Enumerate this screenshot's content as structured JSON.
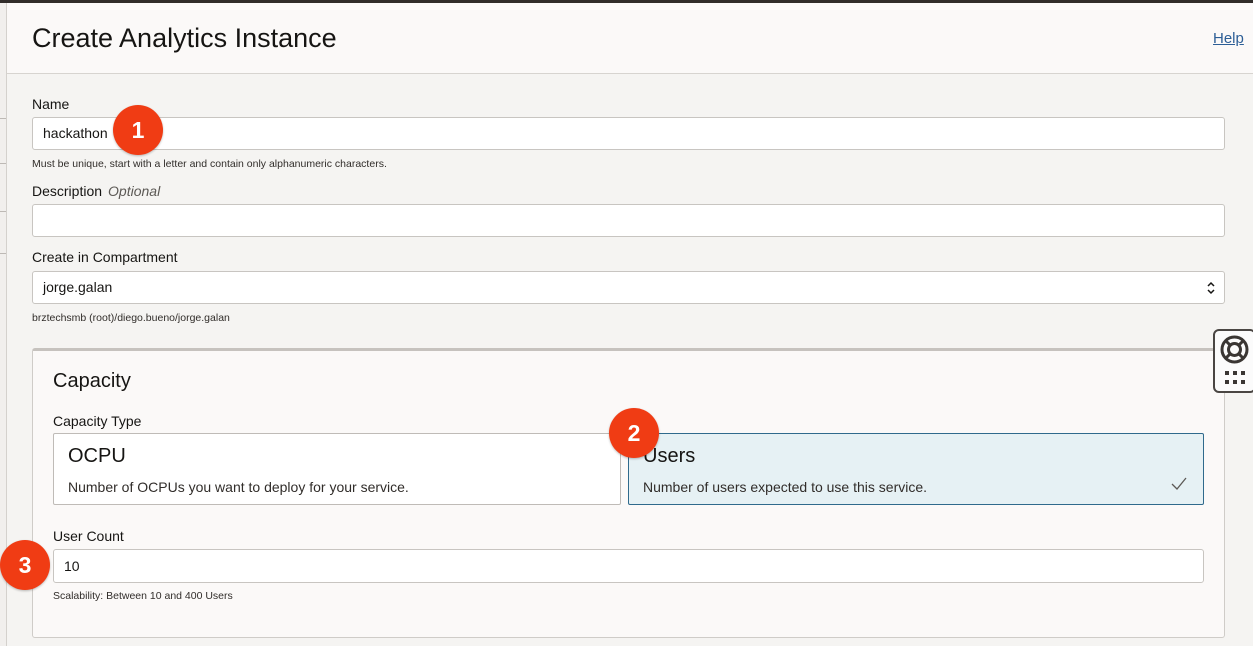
{
  "dialog": {
    "title": "Create Analytics Instance",
    "help_link": "Help"
  },
  "form": {
    "name": {
      "label": "Name",
      "value": "hackathon",
      "hint": "Must be unique, start with a letter and contain only alphanumeric characters."
    },
    "description": {
      "label": "Description",
      "optional": "Optional",
      "value": ""
    },
    "compartment": {
      "label": "Create in Compartment",
      "value": "jorge.galan",
      "path": "brztechsmb (root)/diego.bueno/jorge.galan"
    }
  },
  "capacity": {
    "title": "Capacity",
    "type_label": "Capacity Type",
    "options": [
      {
        "title": "OCPU",
        "description": "Number of OCPUs you want to deploy for your service.",
        "selected": false
      },
      {
        "title": "Users",
        "description": "Number of users expected to use this service.",
        "selected": true
      }
    ],
    "user_count": {
      "label": "User Count",
      "value": "10",
      "hint": "Scalability: Between 10 and 400 Users"
    }
  },
  "annotations": [
    "1",
    "2",
    "3"
  ],
  "icons": {
    "compartment_select": "chevron-updown-icon",
    "selected_tile": "checkmark-icon",
    "help_widget": [
      "lifebuoy-icon",
      "grid-dots-icon"
    ]
  },
  "colors": {
    "link": "#2c5e96",
    "selected_tile_bg": "#e6f1f4",
    "selected_tile_border": "#2f6a8c",
    "annotation_badge": "#f03c14"
  }
}
